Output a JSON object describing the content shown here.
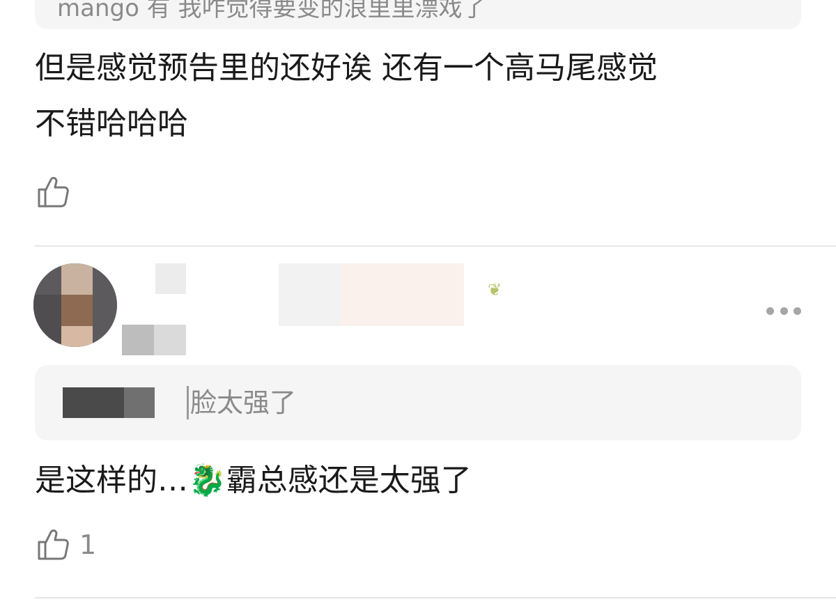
{
  "comments": [
    {
      "quoted": "mango 有 我咋觉得要变的浪里里漂戏了",
      "text_lines": [
        "但是感觉预告里的还好诶 还有一个高马尾感觉",
        "不错哈哈哈"
      ],
      "likes": ""
    },
    {
      "quoted_author_hidden": true,
      "quoted": "脸太强了",
      "text_before_emoji": "是这样的…",
      "emoji": "🐉",
      "text_after_emoji": "霸总感还是太强了",
      "likes": "1"
    }
  ],
  "icons": {
    "like": "thumbs-up-icon",
    "more": "more-horizontal-icon"
  },
  "colors": {
    "quote_bg": "#f5f5f5",
    "muted_text": "#8a8a8a",
    "divider": "#e6e6e6"
  }
}
